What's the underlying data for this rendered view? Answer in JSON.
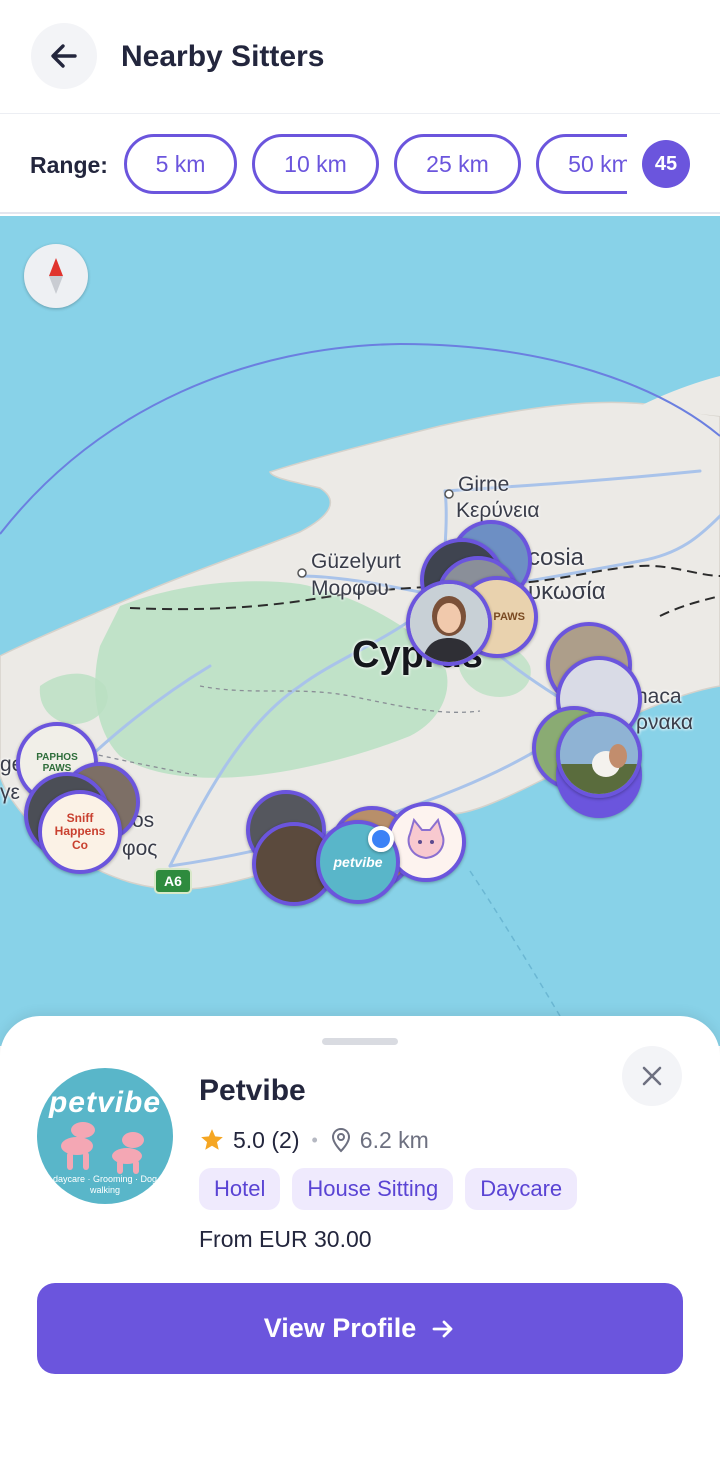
{
  "header": {
    "title": "Nearby Sitters",
    "back_icon": "arrow-left-icon"
  },
  "range": {
    "label": "Range:",
    "options": [
      "5 km",
      "10 km",
      "25 km",
      "50 km"
    ],
    "selected_value": "45"
  },
  "map": {
    "place_labels": {
      "girne": "Girne",
      "keryneia": "Κερύνεια",
      "nicosia": "cosia",
      "lefkosia": "υκωσία",
      "guzelyurt": "Güzelyurt",
      "morfou": "Μορφου",
      "cyprus": "Cyprus",
      "larnaca": "naca",
      "larnaka": "ρνακα",
      "paphos_a": "os",
      "paphos_b": "φος",
      "edge_a": "ge",
      "edge_b": "γε"
    },
    "road_shield": "A6",
    "pin_texts": {
      "paphos_paws": "PAPHOS PAWS",
      "sniff_happens": "Sniff Happens Co",
      "petvibe": "petvibe",
      "pet_paws": "PET PAWS"
    },
    "colors": {
      "sea": "#88d2e8",
      "land": "#eceae6",
      "park": "#b9e0c2",
      "pin_border": "#6b55dd"
    }
  },
  "sheet": {
    "avatar_text": "petvibe",
    "avatar_subtext": "daycare · Grooming · Dog walking",
    "name": "Petvibe",
    "rating": "5.0 (2)",
    "distance": "6.2 km",
    "tags": [
      "Hotel",
      "House Sitting",
      "Daycare"
    ],
    "price": "From EUR 30.00",
    "button_label": "View Profile"
  },
  "colors": {
    "accent": "#6b55dd",
    "tag_bg": "#efeafd",
    "star": "#f5a623"
  }
}
